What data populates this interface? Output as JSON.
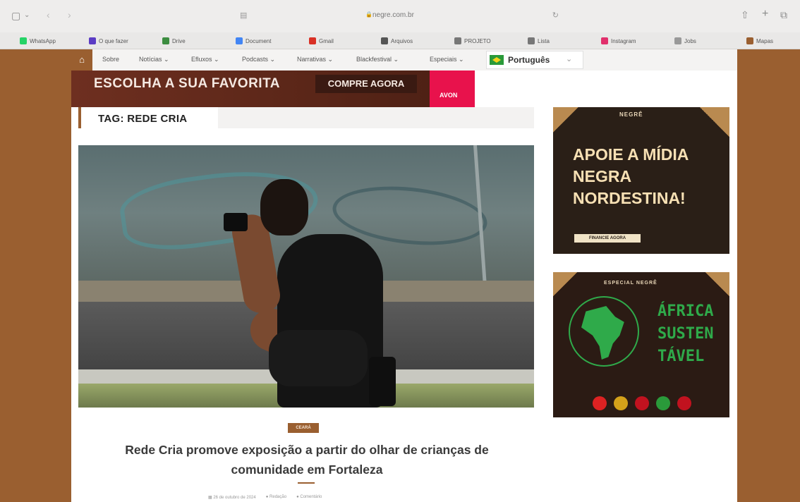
{
  "browser": {
    "url": "negre.com.br",
    "bookmarks": [
      {
        "label": "WhatsApp",
        "color": "#25d366"
      },
      {
        "label": "O que fazer",
        "color": "#5b3cc4"
      },
      {
        "label": "Drive",
        "color": "#3c8d40"
      },
      {
        "label": "Document",
        "color": "#4285f4"
      },
      {
        "label": "Gmail",
        "color": "#d93025"
      },
      {
        "label": "Arquivos",
        "color": "#555555"
      },
      {
        "label": "PROJETO",
        "color": "#777777"
      },
      {
        "label": "Lista",
        "color": "#777777"
      },
      {
        "label": "Instagram",
        "color": "#e1306c"
      },
      {
        "label": "Jobs",
        "color": "#999999"
      },
      {
        "label": "Mapas",
        "color": "#9a5f30"
      }
    ]
  },
  "nav": {
    "items": [
      "Sobre",
      "Notícias",
      "Efluxos",
      "Podcasts",
      "Narrativas",
      "Blackfestival",
      "Especiais"
    ],
    "language": "Português"
  },
  "banner": {
    "headline": "ESCOLHA A SUA FAVORITA",
    "cta": "COMPRE AGORA",
    "brand": "AVON"
  },
  "tag_header": {
    "label": "TAG: REDE CRIA"
  },
  "post": {
    "category": "CEARÁ",
    "title": "Rede Cria promove exposição a partir do olhar de crianças de comunidade em Fortaleza",
    "meta": [
      "26 de outubro de 2024",
      "Redação",
      "Comentário"
    ]
  },
  "sidebar": {
    "ad1": {
      "brand": "NEGRÊ",
      "headline": "APOIE A MÍDIA NEGRA NORDESTINA!",
      "cta": "FINANCIE AGORA"
    },
    "ad2": {
      "label": "ESPECIAL NEGRÊ",
      "headline": "ÁFRICA SUSTEN TÁVEL"
    }
  }
}
